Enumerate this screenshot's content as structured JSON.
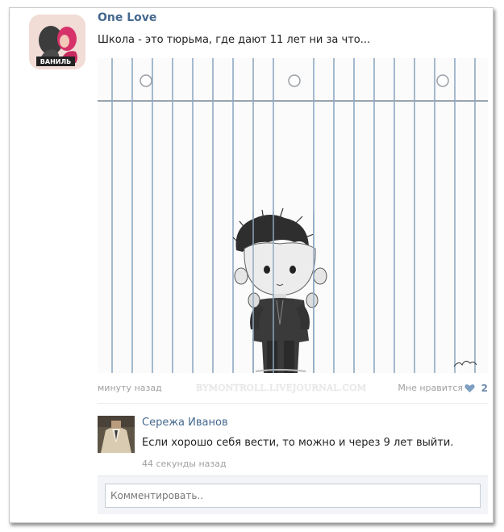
{
  "post": {
    "author": "One Love",
    "text": "Школа - это тюрьма, где дают 11 лет ни за что...",
    "avatar_caption": "ВАНИЛЬ",
    "time": "минуту назад",
    "watermark": "BYMONTROLL.LIVEJOURNAL.COM",
    "like_label": "Мне нравится",
    "like_count": "2"
  },
  "comment": {
    "author": "Сережа Иванов",
    "text": "Если хорошо себя вести, то можно и через 9 лет выйти.",
    "time": "44 секунды назад"
  },
  "comment_input": {
    "placeholder": "Комментировать.."
  },
  "colors": {
    "link": "#45688e",
    "meta": "#a0a0a0",
    "heart": "#7d9fc2"
  }
}
